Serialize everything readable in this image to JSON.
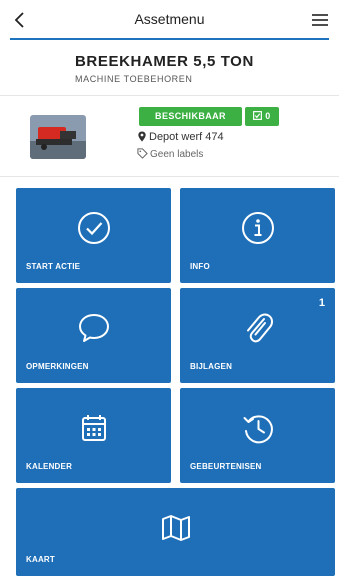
{
  "header": {
    "title": "Assetmenu"
  },
  "asset": {
    "name": "BREEKHAMER 5,5 TON",
    "category": "MACHINE TOEBEHOREN",
    "status": "BESCHIKBAAR",
    "checklist_count": "0",
    "location": "Depot werf 474",
    "labels": "Geen labels"
  },
  "tiles": {
    "start": {
      "label": "START ACTIE"
    },
    "info": {
      "label": "INFO"
    },
    "opmerkingen": {
      "label": "OPMERKINGEN"
    },
    "bijlagen": {
      "label": "BIJLAGEN",
      "count": "1"
    },
    "kalender": {
      "label": "KALENDER"
    },
    "gebeurtenissen": {
      "label": "GEBEURTENISEN"
    },
    "kaart": {
      "label": "KAART"
    }
  },
  "colors": {
    "accent": "#1e73be",
    "tile": "#1e6fb8",
    "status_green": "#3cb043"
  },
  "icons": [
    "back-icon",
    "menu-icon",
    "check-circle-icon",
    "info-icon",
    "comment-icon",
    "paperclip-icon",
    "calendar-icon",
    "history-icon",
    "map-icon",
    "map-marker-icon",
    "tag-icon",
    "checkbox-icon"
  ]
}
